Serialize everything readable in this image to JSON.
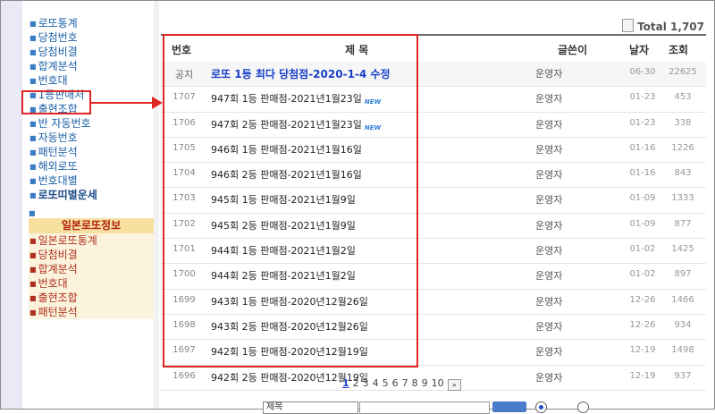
{
  "sidebar": {
    "lotto_items": [
      "로또통계",
      "당첨번호",
      "당첨비결",
      "합계분석",
      "번호대",
      "1등판매처",
      "출현조합",
      "반 자동번호",
      "자동번호",
      "패턴분석",
      "해외로또",
      "번호대별"
    ],
    "lotto_fortune": "로또띠별운세",
    "japan_header": "일본로또정보",
    "japan_items": [
      "일본로또통계",
      "당첨비결",
      "합계분석",
      "번호대",
      "출현조합",
      "패턴분석"
    ]
  },
  "board": {
    "total_label": "Total 1,707",
    "headers": {
      "no": "번호",
      "title": "제 목",
      "writer": "글쓴이",
      "date": "날자",
      "views": "조회"
    },
    "rows": [
      {
        "no": "공지",
        "title": "로또 1등 최다 당첨점-2020-1-4 수정",
        "writer": "운영자",
        "date": "06-30",
        "views": "22625",
        "notice": true,
        "new": false
      },
      {
        "no": "1707",
        "title": "947회 1등 판매점-2021년1월23일",
        "writer": "운영자",
        "date": "01-23",
        "views": "453",
        "new": true
      },
      {
        "no": "1706",
        "title": "947회 2등 판매점-2021년1월23일",
        "writer": "운영자",
        "date": "01-23",
        "views": "338",
        "new": true
      },
      {
        "no": "1705",
        "title": "946회 1등 판매점-2021년1월16일",
        "writer": "운영자",
        "date": "01-16",
        "views": "1226",
        "new": false
      },
      {
        "no": "1704",
        "title": "946회 2등 판매점-2021년1월16일",
        "writer": "운영자",
        "date": "01-16",
        "views": "843",
        "new": false
      },
      {
        "no": "1703",
        "title": "945회 1등 판매점-2021년1월9일",
        "writer": "운영자",
        "date": "01-09",
        "views": "1333",
        "new": false
      },
      {
        "no": "1702",
        "title": "945회 2등 판매점-2021년1월9일",
        "writer": "운영자",
        "date": "01-09",
        "views": "877",
        "new": false
      },
      {
        "no": "1701",
        "title": "944회 1등 판매점-2021년1월2일",
        "writer": "운영자",
        "date": "01-02",
        "views": "1425",
        "new": false
      },
      {
        "no": "1700",
        "title": "944회 2등 판매점-2021년1월2일",
        "writer": "운영자",
        "date": "01-02",
        "views": "897",
        "new": false
      },
      {
        "no": "1699",
        "title": "943회 1등 판매점-2020년12월26일",
        "writer": "운영자",
        "date": "12-26",
        "views": "1466",
        "new": false
      },
      {
        "no": "1698",
        "title": "943회 2등 판매점-2020년12월26일",
        "writer": "운영자",
        "date": "12-26",
        "views": "934",
        "new": false
      },
      {
        "no": "1697",
        "title": "942회 1등 판매점-2020년12월19일",
        "writer": "운영자",
        "date": "12-19",
        "views": "1498",
        "new": false
      },
      {
        "no": "1696",
        "title": "942회 2등 판매점-2020년12월19일",
        "writer": "운영자",
        "date": "12-19",
        "views": "937",
        "new": false
      }
    ],
    "new_badge": "NEW"
  },
  "pagination": {
    "pages": [
      "1",
      "2",
      "3",
      "4",
      "5",
      "6",
      "7",
      "8",
      "9",
      "10"
    ],
    "current": "1",
    "next_icon": "»"
  },
  "search": {
    "field": "제목"
  }
}
